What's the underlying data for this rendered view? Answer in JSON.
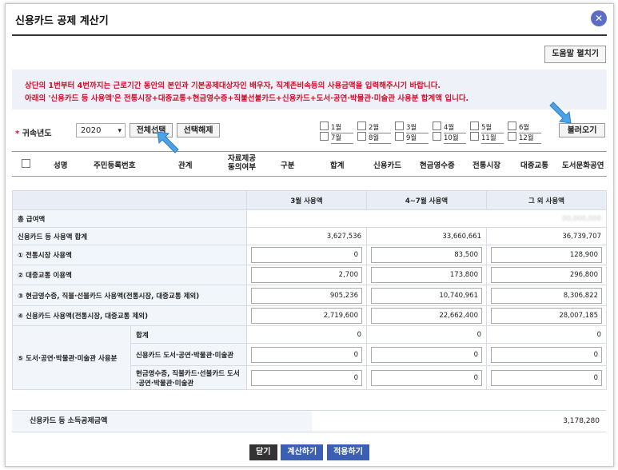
{
  "window": {
    "title": "신용카드 공제 계산기",
    "close_icon": "close-icon"
  },
  "help_button": "도움말 펼치기",
  "notice": {
    "line1": "상단의 1번부터 4번까지는 근로기간 동안의 본인과 기본공제대상자인 배우자, 직계존비속등의 사용금액을 입력해주시기 바랍니다.",
    "line2": "아래의 '신용카드 등 사용액'은 전통시장+대중교통+현금영수증+직불선불카드+신용카드+도서·공연·박물관·미술관 사용분 합계액 입니다."
  },
  "controls": {
    "star": "*",
    "year_label": "귀속년도",
    "year_value": "2020",
    "select_all": "전체선택",
    "deselect_all": "선택해제",
    "months": [
      "1월",
      "2월",
      "3월",
      "4월",
      "5월",
      "6월",
      "7월",
      "8월",
      "9월",
      "10월",
      "11월",
      "12월"
    ],
    "load_button": "불러오기"
  },
  "table_header": {
    "name": "성명",
    "rrn": "주민등록번호",
    "relation": "관계",
    "consent_l1": "자료제공",
    "consent_l2": "동의여부",
    "type": "구분",
    "total": "합계",
    "credit_card": "신용카드",
    "cash_receipt": "현금영수증",
    "traditional_market": "전통시장",
    "public_transport": "대중교통",
    "culture": "도서문화공연"
  },
  "summary": {
    "col_march": "3월 사용액",
    "col_apr_jul": "4~7월 사용액",
    "col_other": "그 외 사용액",
    "total_salary_label": "총 급여액",
    "total_salary_value": "00,000,000",
    "card_total_label": "신용카드 등 사용액 합계",
    "card_total": [
      "3,627,536",
      "33,660,661",
      "36,739,707"
    ],
    "market_label": "① 전통시장 사용액",
    "market": [
      "0",
      "83,500",
      "128,900"
    ],
    "transport_label": "② 대중교통 이용액",
    "transport": [
      "2,700",
      "173,800",
      "296,800"
    ],
    "cash_label": "③ 현금영수증, 직불·선불카드 사용액(전통시장, 대중교통 제외)",
    "cash": [
      "905,236",
      "10,740,961",
      "8,306,822"
    ],
    "credit_label": "④ 신용카드 사용액(전통시장, 대중교통 제외)",
    "credit": [
      "2,719,600",
      "22,662,400",
      "28,007,185"
    ],
    "culture_group_label": "⑤ 도서·공연·박물관·미술관 사용분",
    "culture_sum_label": "합계",
    "culture_sum": [
      "0",
      "0",
      "0"
    ],
    "culture_card_label": "신용카드 도서·공연·박물관·미술관",
    "culture_card": [
      "0",
      "0",
      "0"
    ],
    "culture_cash_label": "현금영수증, 직불카드·선불카드 도서·공연·박물관·미술관",
    "culture_cash": [
      "0",
      "0",
      "0"
    ],
    "deduction_label": "신용카드 등 소득공제금액",
    "deduction_value": "3,178,280"
  },
  "footer": {
    "close": "닫기",
    "calculate": "계산하기",
    "apply": "적용하기"
  },
  "colors": {
    "accent": "#3a5fb4",
    "notice_text": "#d0112b",
    "arrow": "#4aa3e8"
  }
}
